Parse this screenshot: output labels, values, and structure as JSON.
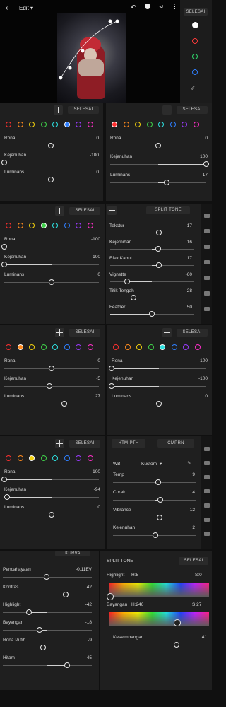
{
  "topbar": {
    "edit_label": "Edit"
  },
  "preset_rail": {
    "button": "SELESAI"
  },
  "colorPanels": {
    "p1": {
      "done": "SELESAI",
      "rona": "Rona",
      "rona_v": "0",
      "kej": "Kejenuhan",
      "kej_v": "-100",
      "lum": "Luminans",
      "lum_v": "0"
    },
    "p2": {
      "done": "SELESAI",
      "rona": "Rona",
      "rona_v": "0",
      "kej": "Kejenuhan",
      "kej_v": "100",
      "lum": "Luminans",
      "lum_v": "17"
    },
    "p3": {
      "done": "SELESAI",
      "rona": "Rona",
      "rona_v": "-100",
      "kej": "Kejenuhan",
      "kej_v": "-100",
      "lum": "Luminans",
      "lum_v": "0"
    },
    "p4": {
      "done": "SELESAI",
      "rona": "Rona",
      "rona_v": "0",
      "kej": "Kejenuhan",
      "kej_v": "-5",
      "lum": "Luminans",
      "lum_v": "27"
    },
    "p5": {
      "done": "SELESAI",
      "rona": "Rona",
      "rona_v": "-100",
      "kej": "Kejenuhan",
      "kej_v": "-100",
      "lum": "Luminans",
      "lum_v": "0"
    },
    "p6": {
      "done": "SELESAI",
      "rona": "Rona",
      "rona_v": "-100",
      "kej": "Kejenuhan",
      "kej_v": "-94",
      "lum": "Luminans",
      "lum_v": "0"
    }
  },
  "effects": {
    "split_tone_btn": "SPLIT TONE",
    "tekstur": "Tekstur",
    "tekstur_v": "17",
    "kejernihan": "Kejernihan",
    "kejernihan_v": "16",
    "kabut": "Efek Kabut",
    "kabut_v": "17",
    "vignette": "Vignette",
    "vignette_v": "-60",
    "titik": "Titik Tengah",
    "titik_v": "28",
    "feather": "Feather",
    "feather_v": "50"
  },
  "wb": {
    "tab1": "HTM-PTH",
    "tab2": "CMPRN",
    "wb": "WB",
    "preset": "Kustom",
    "temp": "Temp",
    "temp_v": "9",
    "corak": "Corak",
    "corak_v": "14",
    "vibrance": "Vibrance",
    "vibrance_v": "12",
    "kej": "Kejenuhan",
    "kej_v": "2"
  },
  "light": {
    "top_tab": "KURVA",
    "pencahayaan": "Pencahayaan",
    "pencahayaan_v": "-0,11EV",
    "kontras": "Kontras",
    "kontras_v": "42",
    "highlight": "Highlight",
    "highlight_v": "-42",
    "bayangan": "Bayangan",
    "bayangan_v": "-18",
    "putih": "Rona Putih",
    "putih_v": "-9",
    "hitam": "Hitam",
    "hitam_v": "45"
  },
  "split": {
    "title": "SPLIT TONE",
    "done": "SELESAI",
    "highlight": "Highlight",
    "h_hue": "H:5",
    "h_sat": "S:0",
    "bayangan": "Bayangan",
    "b_hue": "H:246",
    "b_sat": "S:27",
    "seimbang": "Keseimbangan",
    "seimbang_v": "41"
  },
  "colors": {
    "accent": "#2f8fff"
  }
}
